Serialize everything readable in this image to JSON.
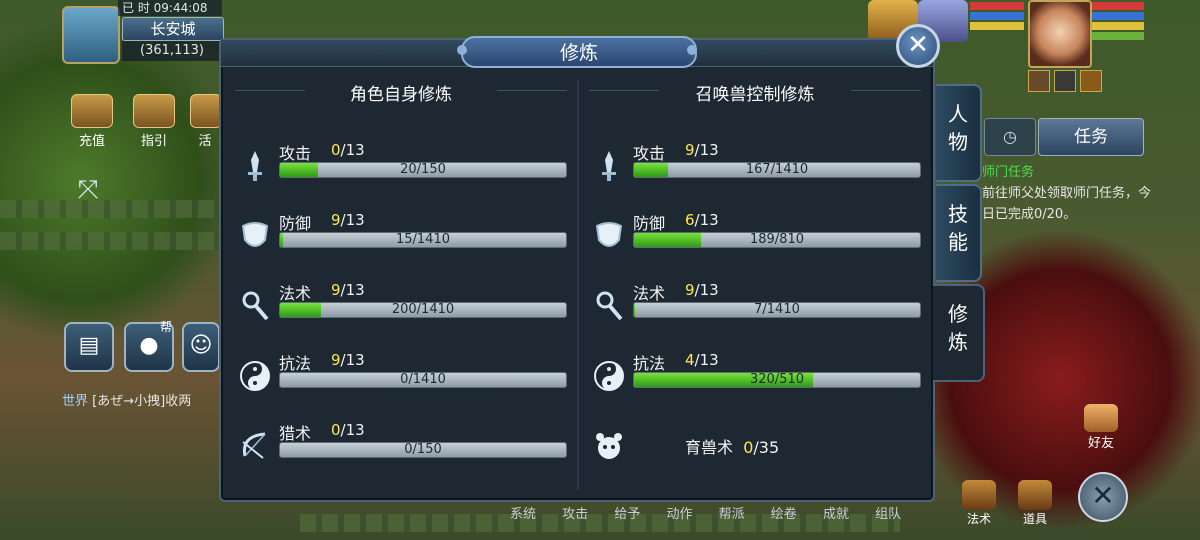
{
  "hud": {
    "time_prefix": "已 时",
    "time": "09:44:08",
    "city": "长安城",
    "coord": "(361,113)",
    "side_buttons": [
      "充值",
      "指引",
      "活"
    ],
    "world_chat_channel": "世界",
    "world_chat_text": "[あぜ→小拽]收两",
    "mic_label": "帮"
  },
  "task": {
    "tab_label": "任务",
    "title": "师门任务",
    "text_before": "前往师父",
    "text_red": "",
    "text_after": "处领取师门任务，今日已完成0/20。"
  },
  "bottom_bar": {
    "menu": [
      "系统",
      "攻击",
      "给予",
      "动作",
      "帮派",
      "绘卷",
      "成就",
      "组队"
    ],
    "spell_label": "法术",
    "items_label": "道具",
    "friend_label": "好友"
  },
  "dialog": {
    "title": "修炼",
    "left": {
      "header": "角色自身修炼",
      "rows": [
        {
          "name": "攻击",
          "level": "0",
          "max": "13",
          "progress": "20/150",
          "fraction": 0.133
        },
        {
          "name": "防御",
          "level": "9",
          "max": "13",
          "progress": "15/1410",
          "fraction": 0.011
        },
        {
          "name": "法术",
          "level": "9",
          "max": "13",
          "progress": "200/1410",
          "fraction": 0.142
        },
        {
          "name": "抗法",
          "level": "9",
          "max": "13",
          "progress": "0/1410",
          "fraction": 0.0
        },
        {
          "name": "猎术",
          "level": "0",
          "max": "13",
          "progress": "0/150",
          "fraction": 0.0
        }
      ]
    },
    "right": {
      "header": "召唤兽控制修炼",
      "rows": [
        {
          "name": "攻击",
          "level": "9",
          "max": "13",
          "progress": "167/1410",
          "fraction": 0.118
        },
        {
          "name": "防御",
          "level": "6",
          "max": "13",
          "progress": "189/810",
          "fraction": 0.233
        },
        {
          "name": "法术",
          "level": "9",
          "max": "13",
          "progress": "7/1410",
          "fraction": 0.005
        },
        {
          "name": "抗法",
          "level": "4",
          "max": "13",
          "progress": "320/510",
          "fraction": 0.627
        }
      ],
      "extra": {
        "name": "育兽术",
        "level": "0",
        "max": "35"
      }
    },
    "tabs": [
      "人物",
      "技能",
      "修炼"
    ],
    "active_tab": "修炼"
  },
  "colors": {
    "level_highlight": "#ffe84a",
    "bar_fill": "#4fc52a",
    "panel_bg": "#1d2833"
  }
}
